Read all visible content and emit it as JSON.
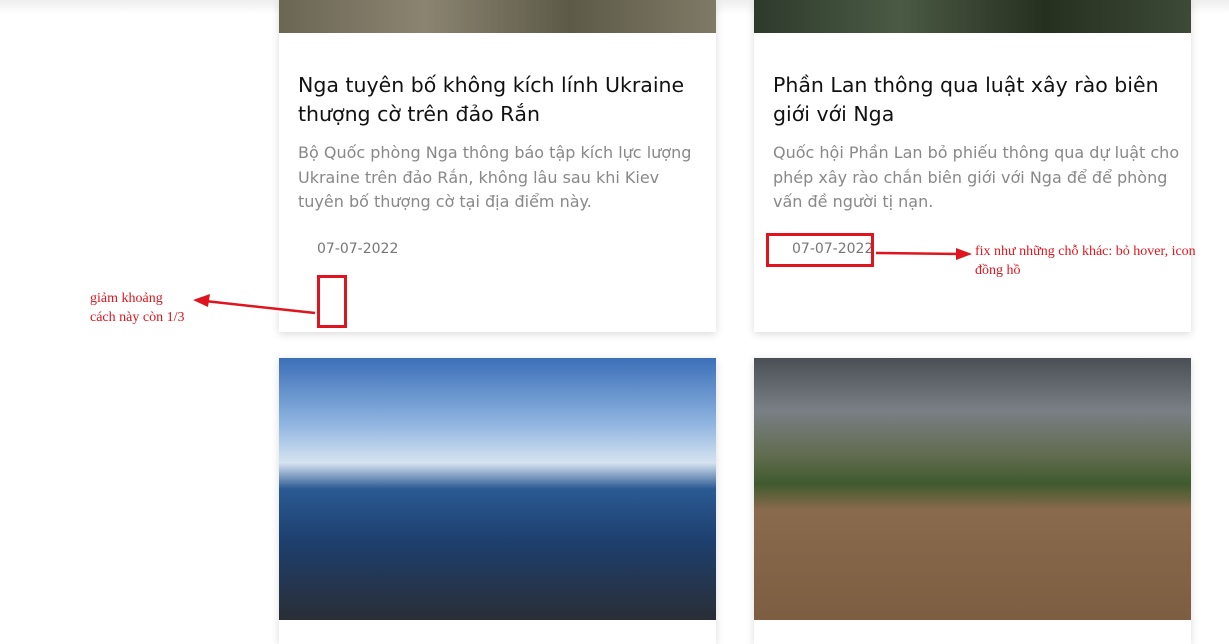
{
  "cards": [
    {
      "title": "Nga tuyên bố không kích lính Ukraine thượng cờ trên đảo Rắn",
      "description": "Bộ Quốc phòng Nga thông báo tập kích lực lượng Ukraine trên đảo Rắn, không lâu sau khi Kiev tuyên bố thượng cờ tại địa điểm này.",
      "date": "07-07-2022"
    },
    {
      "title": "Phần Lan thông qua luật xây rào biên giới với Nga",
      "description": "Quốc hội Phần Lan bỏ phiếu thông qua dự luật cho phép xây rào chắn biên giới với Nga để để phòng vấn đề người tị nạn.",
      "date": "07-07-2022"
    }
  ],
  "annotations": {
    "spacing_note": "giảm khoảng cách này còn 1/3",
    "date_note": "fix như những chỗ khác: bỏ hover, icon đồng hồ",
    "color": "#e0141e"
  }
}
